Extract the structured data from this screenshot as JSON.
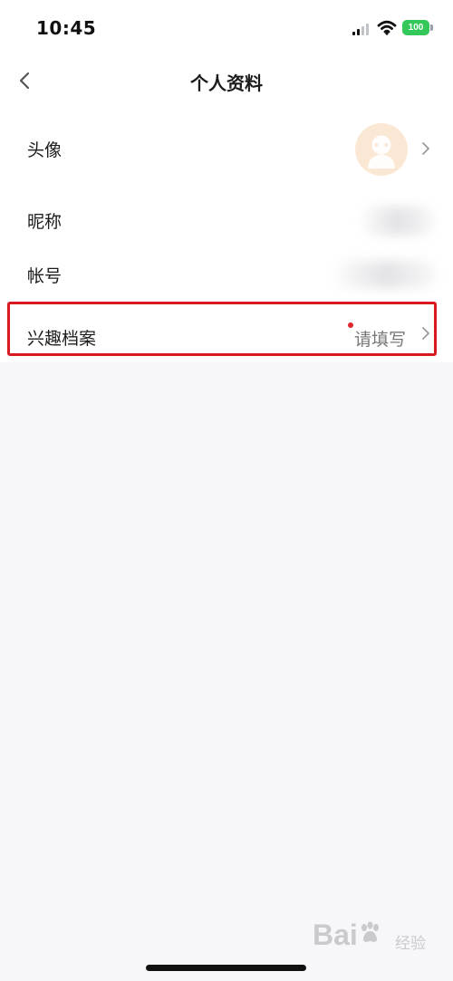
{
  "status_bar": {
    "time": "10:45",
    "battery_level": "100"
  },
  "navigation": {
    "title": "个人资料"
  },
  "profile": {
    "rows": [
      {
        "label": "头像"
      },
      {
        "label": "昵称"
      },
      {
        "label": "帐号"
      },
      {
        "label": "兴趣档案",
        "value": "请填写"
      }
    ]
  },
  "watermark": {
    "brand": "Bai",
    "suffix": "经验"
  },
  "colors": {
    "highlight": "#d71920",
    "battery": "#34c759",
    "avatar_background": "#fbe8d4",
    "notification_dot": "#e0262d"
  },
  "icons": [
    "back-icon",
    "signal-icon",
    "wifi-icon",
    "battery-icon",
    "chevron-right-icon",
    "baidu-paw-icon"
  ]
}
